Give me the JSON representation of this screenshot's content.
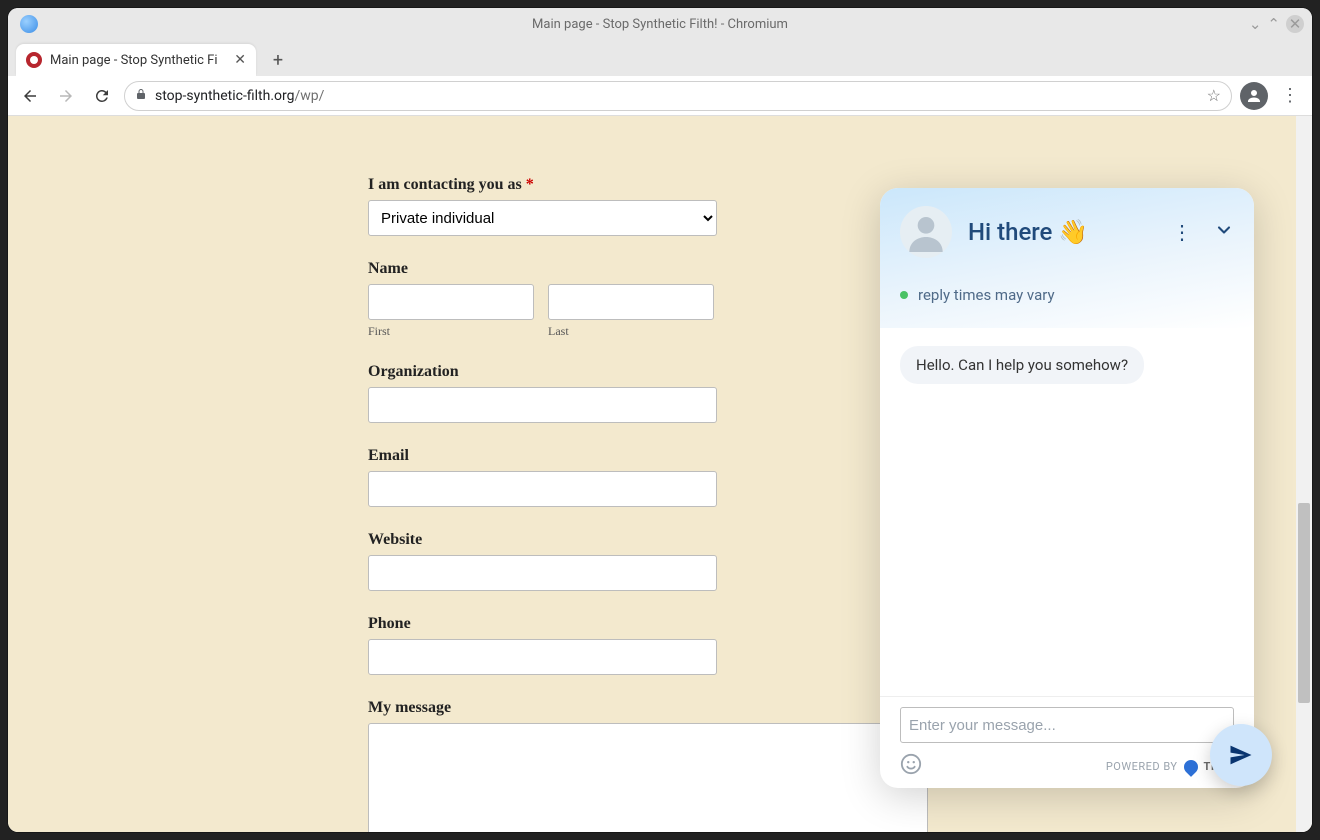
{
  "window": {
    "title": "Main page - Stop Synthetic Filth! - Chromium"
  },
  "tab": {
    "title": "Main page - Stop Synthetic Fi"
  },
  "omnibox": {
    "host": "stop-synthetic-filth.org",
    "path": "/wp/"
  },
  "form": {
    "contacting_as": {
      "label": "I am contacting you as",
      "required": "*",
      "selected": "Private individual"
    },
    "name_label": "Name",
    "first_label": "First",
    "last_label": "Last",
    "organization_label": "Organization",
    "email_label": "Email",
    "website_label": "Website",
    "phone_label": "Phone",
    "message_label": "My message",
    "first_value": "",
    "last_value": "",
    "organization_value": "",
    "email_value": "",
    "website_value": "",
    "phone_value": "",
    "message_value": ""
  },
  "chat": {
    "title": "Hi there",
    "wave": "👋",
    "status": "reply times may vary",
    "message": "Hello. Can I help you somehow?",
    "input_placeholder": "Enter your message...",
    "powered_by": "POWERED BY",
    "brand": "TIDIO"
  }
}
